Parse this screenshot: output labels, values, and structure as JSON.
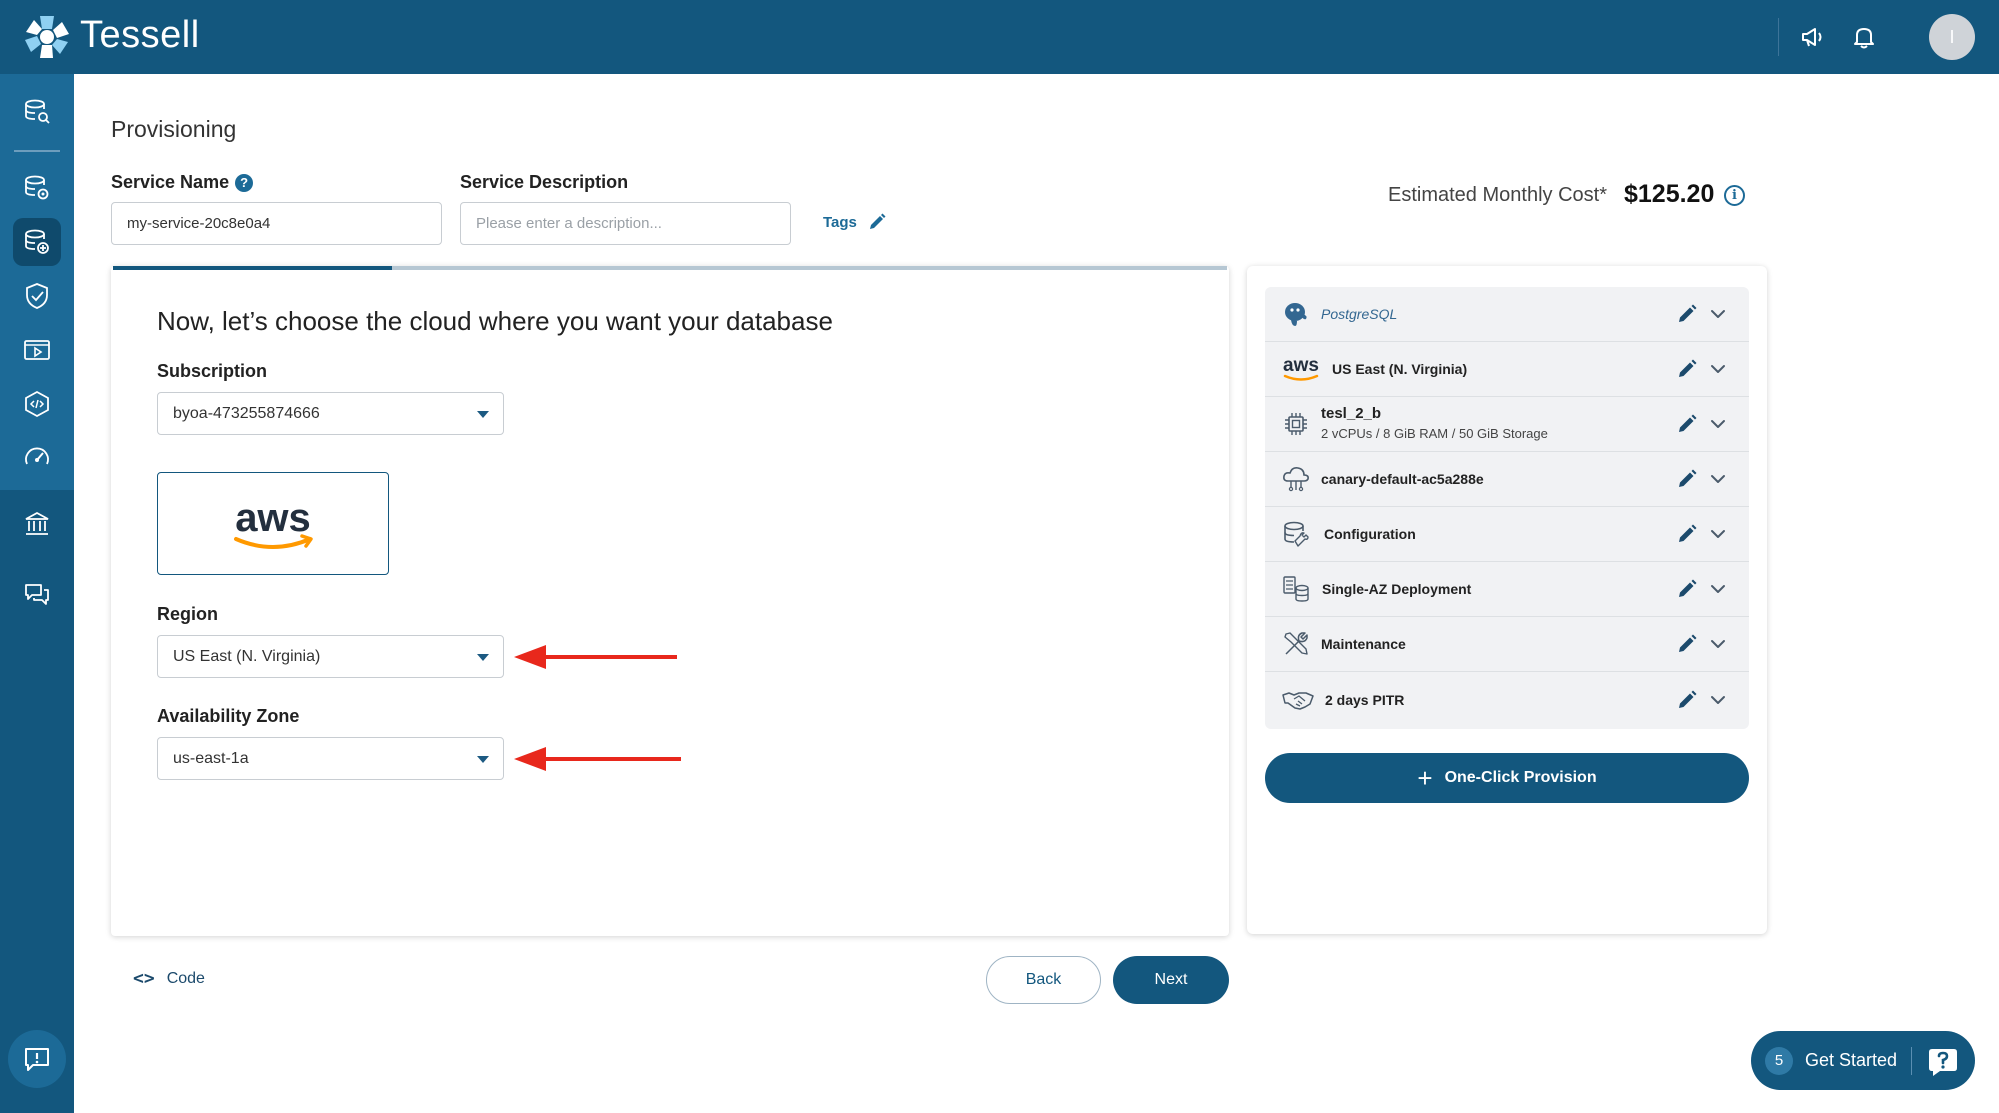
{
  "app": {
    "brand": "Tessell"
  },
  "header": {
    "avatar_initial": "I"
  },
  "page": {
    "title": "Provisioning"
  },
  "form": {
    "service_name_label": "Service Name",
    "service_name_help": "?",
    "service_name_value": "my-service-20c8e0a4",
    "service_description_label": "Service Description",
    "service_description_placeholder": "Please enter a description...",
    "tags_label": "Tags"
  },
  "cost": {
    "label": "Estimated Monthly Cost*",
    "value": "$125.20",
    "info_glyph": "i"
  },
  "wizard": {
    "progress": 0.25,
    "heading": "Now, let’s choose the cloud where you want your database",
    "subscription_label": "Subscription",
    "subscription_value": "byoa-473255874666",
    "cloud_provider_logo": "aws",
    "region_label": "Region",
    "region_value": "US East (N. Virginia)",
    "az_label": "Availability Zone",
    "az_value": "us-east-1a"
  },
  "summary": {
    "items": [
      {
        "icon": "postgresql-icon",
        "label": "PostgreSQL",
        "sub": ""
      },
      {
        "icon": "aws-icon",
        "label": "US East (N. Virginia)",
        "sub": ""
      },
      {
        "icon": "chip-icon",
        "label": "tesl_2_b",
        "sub": "2 vCPUs / 8 GiB RAM / 50 GiB Storage"
      },
      {
        "icon": "cloud-network-icon",
        "label": "canary-default-ac5a288e",
        "sub": ""
      },
      {
        "icon": "database-settings-icon",
        "label": "Configuration",
        "sub": ""
      },
      {
        "icon": "deployment-icon",
        "label": "Single-AZ Deployment",
        "sub": ""
      },
      {
        "icon": "tools-icon",
        "label": "Maintenance",
        "sub": ""
      },
      {
        "icon": "handshake-icon",
        "label": "2 days PITR",
        "sub": ""
      }
    ],
    "provision_label": "One-Click Provision"
  },
  "footer": {
    "code_label": "Code",
    "back_label": "Back",
    "next_label": "Next"
  },
  "get_started": {
    "count": "5",
    "label": "Get Started"
  },
  "colors": {
    "primary": "#13577e",
    "sidebar_highlight": "#1c6a97",
    "arrow": "#e8281c"
  }
}
